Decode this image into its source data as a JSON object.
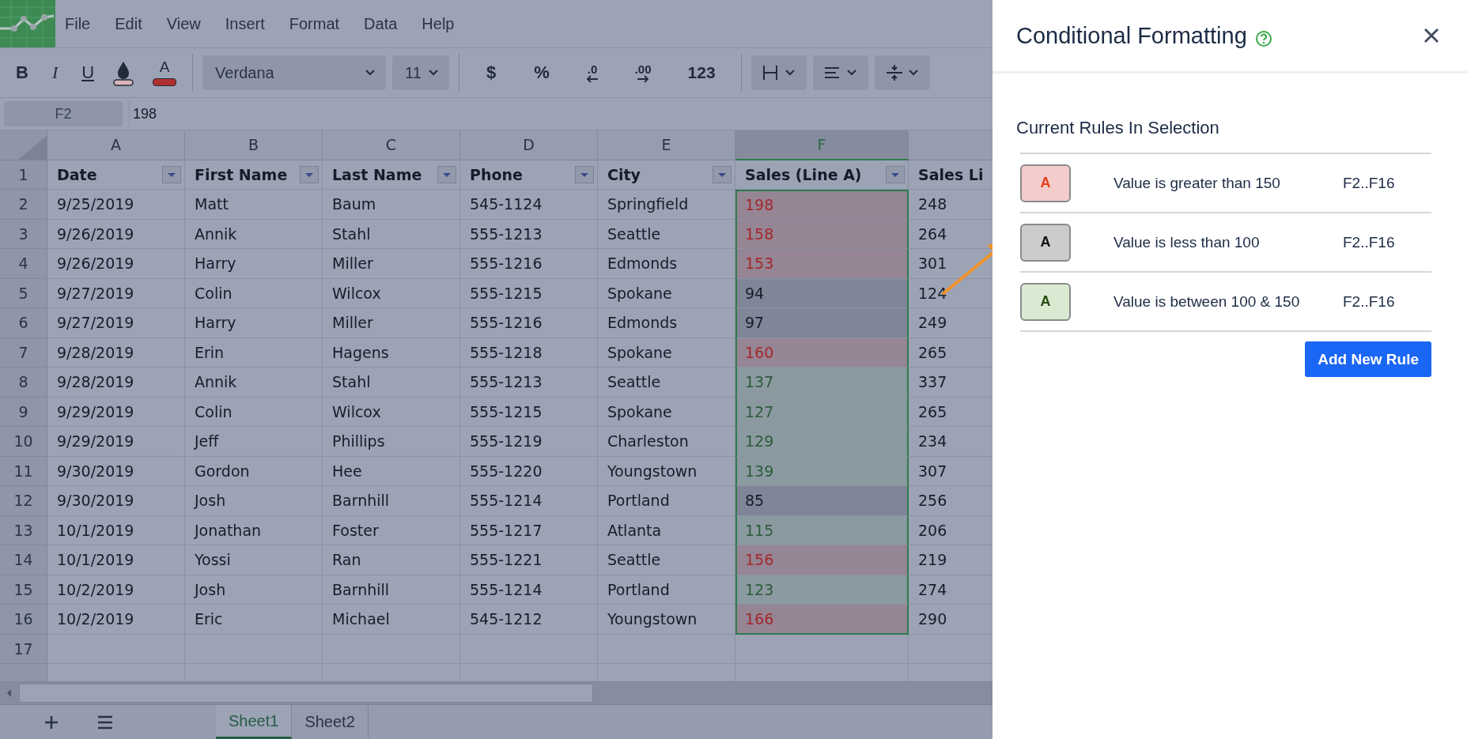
{
  "menu": [
    "File",
    "Edit",
    "View",
    "Insert",
    "Format",
    "Data",
    "Help"
  ],
  "toolbar": {
    "bold": "B",
    "italic": "I",
    "underline": "U",
    "font_color": "A",
    "font": "Verdana",
    "size": "11",
    "currency": "$",
    "percent": "%",
    "decrease_decimals": ".0",
    "increase_decimals": ".00",
    "number_format": "123"
  },
  "formula_bar": {
    "name_box": "F2",
    "value": "198"
  },
  "columns": [
    {
      "letter": "A",
      "selected": false
    },
    {
      "letter": "B",
      "selected": false
    },
    {
      "letter": "C",
      "selected": false
    },
    {
      "letter": "D",
      "selected": false
    },
    {
      "letter": "E",
      "selected": false
    },
    {
      "letter": "F",
      "selected": true
    }
  ],
  "header_row_number": "1",
  "headers": [
    {
      "text": "Date",
      "filter": true
    },
    {
      "text": "First Name",
      "filter": true
    },
    {
      "text": "Last Name",
      "filter": true
    },
    {
      "text": "Phone",
      "filter": true
    },
    {
      "text": "City",
      "filter": true
    },
    {
      "text": "Sales (Line A)",
      "filter": true
    },
    {
      "text": "Sales Li",
      "filter": false
    }
  ],
  "rows": [
    {
      "number": "2",
      "cells": [
        "9/25/2019",
        "Matt",
        "Baum",
        "545-1124",
        "Springfield"
      ],
      "sales": {
        "value": "198",
        "kind": "greater"
      },
      "next": "248"
    },
    {
      "number": "3",
      "cells": [
        "9/26/2019",
        "Annik",
        "Stahl",
        "555-1213",
        "Seattle"
      ],
      "sales": {
        "value": "158",
        "kind": "greater"
      },
      "next": "264"
    },
    {
      "number": "4",
      "cells": [
        "9/26/2019",
        "Harry",
        "Miller",
        "555-1216",
        "Edmonds"
      ],
      "sales": {
        "value": "153",
        "kind": "greater"
      },
      "next": "301"
    },
    {
      "number": "5",
      "cells": [
        "9/27/2019",
        "Colin",
        "Wilcox",
        "555-1215",
        "Spokane"
      ],
      "sales": {
        "value": "94",
        "kind": "less"
      },
      "next": "124"
    },
    {
      "number": "6",
      "cells": [
        "9/27/2019",
        "Harry",
        "Miller",
        "555-1216",
        "Edmonds"
      ],
      "sales": {
        "value": "97",
        "kind": "less"
      },
      "next": "249"
    },
    {
      "number": "7",
      "cells": [
        "9/28/2019",
        "Erin",
        "Hagens",
        "555-1218",
        "Spokane"
      ],
      "sales": {
        "value": "160",
        "kind": "greater"
      },
      "next": "265"
    },
    {
      "number": "8",
      "cells": [
        "9/28/2019",
        "Annik",
        "Stahl",
        "555-1213",
        "Seattle"
      ],
      "sales": {
        "value": "137",
        "kind": "between"
      },
      "next": "337"
    },
    {
      "number": "9",
      "cells": [
        "9/29/2019",
        "Colin",
        "Wilcox",
        "555-1215",
        "Spokane"
      ],
      "sales": {
        "value": "127",
        "kind": "between"
      },
      "next": "265"
    },
    {
      "number": "10",
      "cells": [
        "9/29/2019",
        "Jeff",
        "Phillips",
        "555-1219",
        "Charleston"
      ],
      "sales": {
        "value": "129",
        "kind": "between"
      },
      "next": "234"
    },
    {
      "number": "11",
      "cells": [
        "9/30/2019",
        "Gordon",
        "Hee",
        "555-1220",
        "Youngstown"
      ],
      "sales": {
        "value": "139",
        "kind": "between"
      },
      "next": "307"
    },
    {
      "number": "12",
      "cells": [
        "9/30/2019",
        "Josh",
        "Barnhill",
        "555-1214",
        "Portland"
      ],
      "sales": {
        "value": "85",
        "kind": "less"
      },
      "next": "256"
    },
    {
      "number": "13",
      "cells": [
        "10/1/2019",
        "Jonathan",
        "Foster",
        "555-1217",
        "Atlanta"
      ],
      "sales": {
        "value": "115",
        "kind": "between"
      },
      "next": "206"
    },
    {
      "number": "14",
      "cells": [
        "10/1/2019",
        "Yossi",
        "Ran",
        "555-1221",
        "Seattle"
      ],
      "sales": {
        "value": "156",
        "kind": "greater"
      },
      "next": "219"
    },
    {
      "number": "15",
      "cells": [
        "10/2/2019",
        "Josh",
        "Barnhill",
        "555-1214",
        "Portland"
      ],
      "sales": {
        "value": "123",
        "kind": "between"
      },
      "next": "274"
    },
    {
      "number": "16",
      "cells": [
        "10/2/2019",
        "Eric",
        "Michael",
        "545-1212",
        "Youngstown"
      ],
      "sales": {
        "value": "166",
        "kind": "greater"
      },
      "next": "290"
    }
  ],
  "empty_rows": [
    "17"
  ],
  "sheets": [
    {
      "name": "Sheet1",
      "selected": true
    },
    {
      "name": "Sheet2",
      "selected": false
    }
  ],
  "panel": {
    "title": "Conditional Formatting",
    "section": "Current Rules In Selection",
    "rules": [
      {
        "kind": "greater",
        "swatch": "A",
        "text": "Value is greater than 150",
        "range": "F2..F16"
      },
      {
        "kind": "less",
        "swatch": "A",
        "text": "Value is less than 100",
        "range": "F2..F16"
      },
      {
        "kind": "between",
        "swatch": "A",
        "text": "Value is between 100 & 150",
        "range": "F2..F16"
      }
    ],
    "button": "Add New Rule"
  }
}
